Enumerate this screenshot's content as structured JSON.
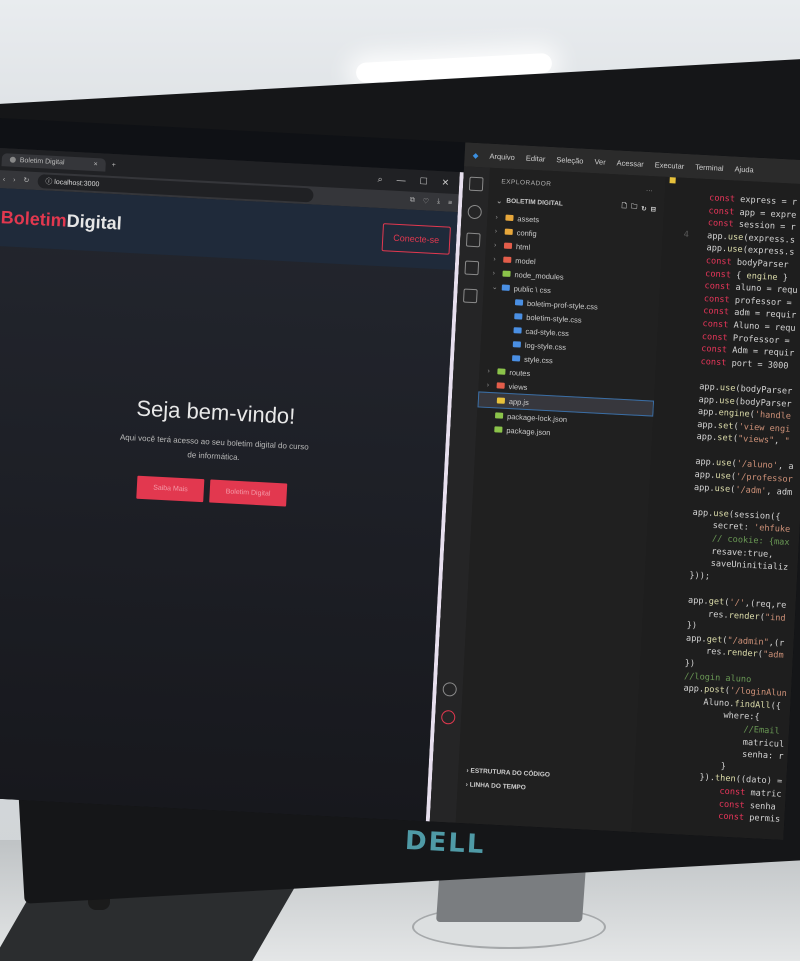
{
  "browser": {
    "tab_title": "Boletim Digital",
    "tab_close": "×",
    "new_tab": "+",
    "url": "localhost:3000",
    "site": {
      "brand_prefix": "Boletim",
      "brand_suffix": "Digital",
      "connect_button": "Conecte-se",
      "hero_title": "Seja bem-vindo!",
      "hero_text": "Aqui você terá acesso ao seu boletim digital do curso de informática.",
      "button_primary": "Saiba Mais",
      "button_secondary": "Boletim Digital"
    }
  },
  "vscode": {
    "menu": [
      "Arquivo",
      "Editar",
      "Seleção",
      "Ver",
      "Acessar",
      "Executar",
      "Terminal",
      "Ajuda"
    ],
    "explorer_title": "EXPLORADOR",
    "explorer_more": "...",
    "project": "BOLETIM DIGITAL",
    "tree": [
      {
        "label": "assets",
        "depth": 1,
        "type": "folder",
        "color": "#e7a73b"
      },
      {
        "label": "config",
        "depth": 1,
        "type": "folder",
        "color": "#e7a73b"
      },
      {
        "label": "html",
        "depth": 1,
        "type": "folder",
        "color": "#e35d4a"
      },
      {
        "label": "model",
        "depth": 1,
        "type": "folder",
        "color": "#e35d4a"
      },
      {
        "label": "node_modules",
        "depth": 1,
        "type": "folder",
        "color": "#8bc34a"
      },
      {
        "label": "public \\ css",
        "depth": 1,
        "type": "folder-open",
        "color": "#4a8fe3"
      },
      {
        "label": "boletim-prof-style.css",
        "depth": 2,
        "type": "css",
        "color": "#4a8fe3"
      },
      {
        "label": "boletim-style.css",
        "depth": 2,
        "type": "css",
        "color": "#4a8fe3"
      },
      {
        "label": "cad-style.css",
        "depth": 2,
        "type": "css",
        "color": "#4a8fe3"
      },
      {
        "label": "log-style.css",
        "depth": 2,
        "type": "css",
        "color": "#4a8fe3"
      },
      {
        "label": "style.css",
        "depth": 2,
        "type": "css",
        "color": "#4a8fe3"
      },
      {
        "label": "routes",
        "depth": 1,
        "type": "folder",
        "color": "#8bc34a"
      },
      {
        "label": "views",
        "depth": 1,
        "type": "folder",
        "color": "#e35d4a"
      },
      {
        "label": "app.js",
        "depth": 1,
        "type": "js",
        "color": "#e7c13b",
        "selected": true
      },
      {
        "label": "package-lock.json",
        "depth": 1,
        "type": "json",
        "color": "#8bc34a"
      },
      {
        "label": "package.json",
        "depth": 1,
        "type": "json",
        "color": "#8bc34a"
      }
    ],
    "outline": "ESTRUTURA DO CÓDIGO",
    "timeline": "LINHA DO TEMPO",
    "code_lines": [
      {
        "n": "",
        "text": "  const express = r"
      },
      {
        "n": "",
        "text": "  const app = expre"
      },
      {
        "n": "",
        "text": "  const session = r"
      },
      {
        "n": "4",
        "text": "  app.use(express.s"
      },
      {
        "n": "",
        "text": "  app.use(express.s"
      },
      {
        "n": "",
        "text": "  const bodyParser "
      },
      {
        "n": "",
        "text": "  const { engine } "
      },
      {
        "n": "",
        "text": "  const aluno = requ"
      },
      {
        "n": "",
        "text": "  const professor = "
      },
      {
        "n": "",
        "text": "  const adm = requir"
      },
      {
        "n": "",
        "text": "  const Aluno = requ"
      },
      {
        "n": "",
        "text": "  const Professor = "
      },
      {
        "n": "",
        "text": "  const Adm = requir"
      },
      {
        "n": "",
        "text": "  const port = 3000"
      },
      {
        "n": "",
        "text": ""
      },
      {
        "n": "",
        "text": "  app.use(bodyParser"
      },
      {
        "n": "",
        "text": "  app.use(bodyParser"
      },
      {
        "n": "",
        "text": "  app.engine('handle"
      },
      {
        "n": "",
        "text": "  app.set('view engi"
      },
      {
        "n": "",
        "text": "  app.set(\"views\", \""
      },
      {
        "n": "",
        "text": ""
      },
      {
        "n": "",
        "text": "  app.use('/aluno', a"
      },
      {
        "n": "",
        "text": "  app.use('/professor"
      },
      {
        "n": "",
        "text": "  app.use('/adm', adm"
      },
      {
        "n": "",
        "text": ""
      },
      {
        "n": "",
        "text": "  app.use(session({"
      },
      {
        "n": "",
        "text": "      secret: 'ehfuke"
      },
      {
        "n": "",
        "text": "      // cookie: {max"
      },
      {
        "n": "",
        "text": "      resave:true,"
      },
      {
        "n": "",
        "text": "      saveUninitializ"
      },
      {
        "n": "",
        "text": "  }));"
      },
      {
        "n": "",
        "text": ""
      },
      {
        "n": "",
        "text": "  app.get('/',(req,re"
      },
      {
        "n": "",
        "text": "      res.render(\"ind"
      },
      {
        "n": "",
        "text": "  })"
      },
      {
        "n": "",
        "text": "  app.get(\"/admin\",(r"
      },
      {
        "n": "",
        "text": "      res.render(\"adm"
      },
      {
        "n": "",
        "text": "  })"
      },
      {
        "n": "",
        "text": "  //login aluno"
      },
      {
        "n": "",
        "text": "  app.post('/loginAlun"
      },
      {
        "n": "",
        "text": "      Aluno.findAll({"
      },
      {
        "n": "",
        "text": "          where:{"
      },
      {
        "n": "",
        "text": "              //Email"
      },
      {
        "n": "",
        "text": "              matricul"
      },
      {
        "n": "",
        "text": "              senha: r"
      },
      {
        "n": "",
        "text": "          }"
      },
      {
        "n": "",
        "text": "      }).then((dato) ="
      },
      {
        "n": "",
        "text": "          const matric"
      },
      {
        "n": "",
        "text": "          const senha "
      },
      {
        "n": "",
        "text": "          const permis"
      }
    ]
  },
  "monitor_brand": "DELL",
  "colors": {
    "accent": "#e2384f",
    "navbar": "#1f2a3a",
    "editor_bg": "#1e1e1e"
  }
}
